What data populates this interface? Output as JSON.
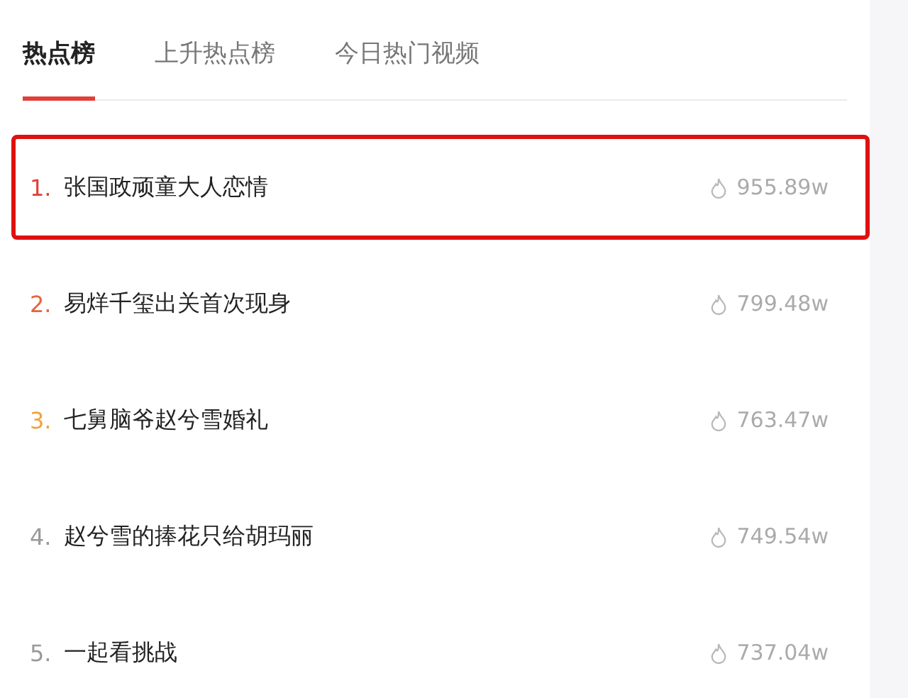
{
  "tabs": [
    {
      "label": "热点榜",
      "selected": true
    },
    {
      "label": "上升热点榜",
      "selected": false
    },
    {
      "label": "今日热门视频",
      "selected": false
    }
  ],
  "items": [
    {
      "rank": "1.",
      "title": "张国政顽童大人恋情",
      "heat": "955.89w",
      "color": "#e0403a",
      "highlighted": true
    },
    {
      "rank": "2.",
      "title": "易烊千玺出关首次现身",
      "heat": "799.48w",
      "color": "#e8643c",
      "highlighted": false
    },
    {
      "rank": "3.",
      "title": "七舅脑爷赵兮雪婚礼",
      "heat": "763.47w",
      "color": "#f0a23c",
      "highlighted": false
    },
    {
      "rank": "4.",
      "title": "赵兮雪的捧花只给胡玛丽",
      "heat": "749.54w",
      "color": "#999999",
      "highlighted": false
    },
    {
      "rank": "5.",
      "title": "一起看挑战",
      "heat": "737.04w",
      "color": "#999999",
      "highlighted": false
    }
  ]
}
